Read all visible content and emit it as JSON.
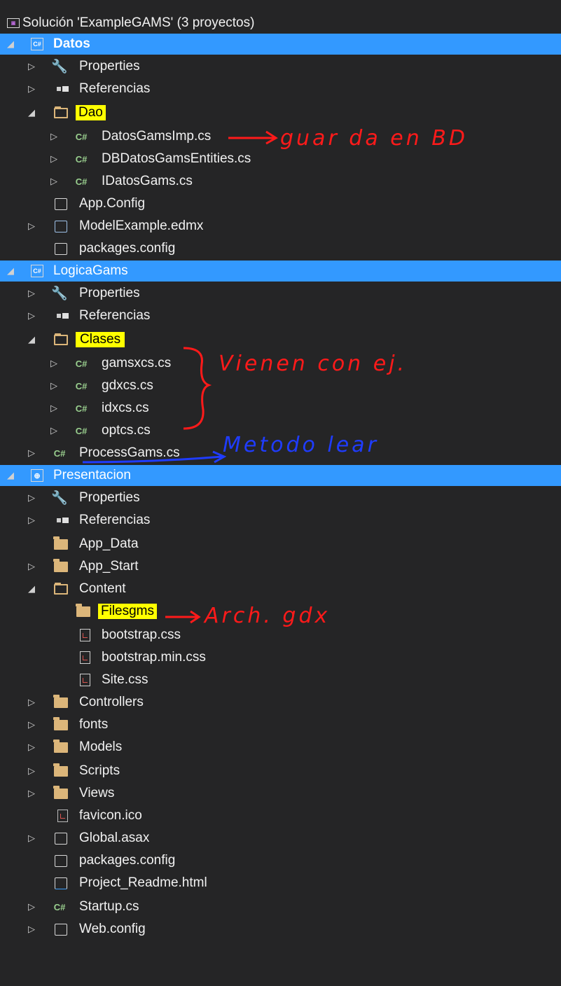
{
  "solution": {
    "title": "Solución 'ExampleGAMS'  (3 proyectos)"
  },
  "projects": [
    {
      "name": "Datos"
    },
    {
      "name": "LogicaGams"
    },
    {
      "name": "Presentacion"
    }
  ],
  "items": {
    "properties": "Properties",
    "referencias": "Referencias",
    "dao": "Dao",
    "datos_gams_imp": "DatosGamsImp.cs",
    "db_datos_gams_entities": "DBDatosGamsEntities.cs",
    "idatos_gams": "IDatosGams.cs",
    "app_config": "App.Config",
    "model_example": "ModelExample.edmx",
    "packages_config": "packages.config",
    "clases": "Clases",
    "gamsxcs": "gamsxcs.cs",
    "gdxcs": "gdxcs.cs",
    "idxcs": "idxcs.cs",
    "optcs": "optcs.cs",
    "process_gams": "ProcessGams.cs",
    "app_data": "App_Data",
    "app_start": "App_Start",
    "content": "Content",
    "filesgms": "Filesgms",
    "bootstrap_css": "bootstrap.css",
    "bootstrap_min_css": "bootstrap.min.css",
    "site_css": "Site.css",
    "controllers": "Controllers",
    "fonts": "fonts",
    "models": "Models",
    "scripts": "Scripts",
    "views": "Views",
    "favicon": "favicon.ico",
    "global_asax": "Global.asax",
    "project_readme": "Project_Readme.html",
    "startup": "Startup.cs",
    "web_config": "Web.config"
  },
  "annotations": {
    "guarda": "guar da en BD",
    "vienen": "Vienen con ej.",
    "metodo": "Metodo lear",
    "arch": "Arch. gdx"
  },
  "colors": {
    "background": "#252526",
    "selection": "#3399ff",
    "highlight": "#ffff00",
    "annotation_red": "#ff1a1a",
    "annotation_blue": "#1f3cff"
  }
}
